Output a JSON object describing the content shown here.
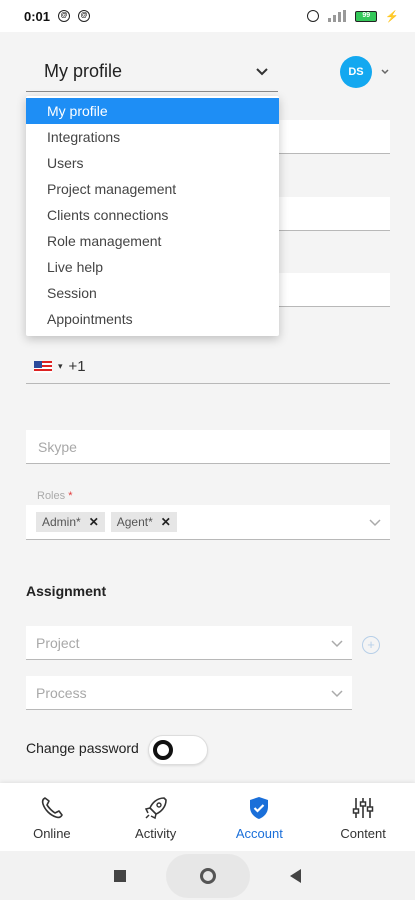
{
  "status_bar": {
    "time": "0:01",
    "icon_a": "@",
    "icon_b": "@",
    "battery": "99"
  },
  "header": {
    "selected_page": "My profile",
    "avatar_initials": "DS"
  },
  "menu": {
    "items": [
      {
        "label": "My profile",
        "active": true
      },
      {
        "label": "Integrations"
      },
      {
        "label": "Users"
      },
      {
        "label": "Project management"
      },
      {
        "label": "Clients connections"
      },
      {
        "label": "Role management"
      },
      {
        "label": "Live help"
      },
      {
        "label": "Session"
      },
      {
        "label": "Appointments"
      }
    ]
  },
  "form": {
    "phone_code": "+1",
    "skype_placeholder": "Skype",
    "roles_label": "Roles",
    "roles_required_mark": "*",
    "roles": [
      "Admin*",
      "Agent*"
    ],
    "assignment_title": "Assignment",
    "project_placeholder": "Project",
    "process_placeholder": "Process",
    "change_password_label": "Change password",
    "change_password_enabled": false
  },
  "bottom_nav": {
    "items": [
      {
        "label": "Online",
        "icon": "phone-icon"
      },
      {
        "label": "Activity",
        "icon": "rocket-icon"
      },
      {
        "label": "Account",
        "icon": "shield-check-icon",
        "active": true
      },
      {
        "label": "Content",
        "icon": "sliders-icon"
      }
    ]
  },
  "colors": {
    "accent": "#1e8ef5",
    "avatar": "#13a8f0",
    "active_nav": "#1a6fd9"
  }
}
